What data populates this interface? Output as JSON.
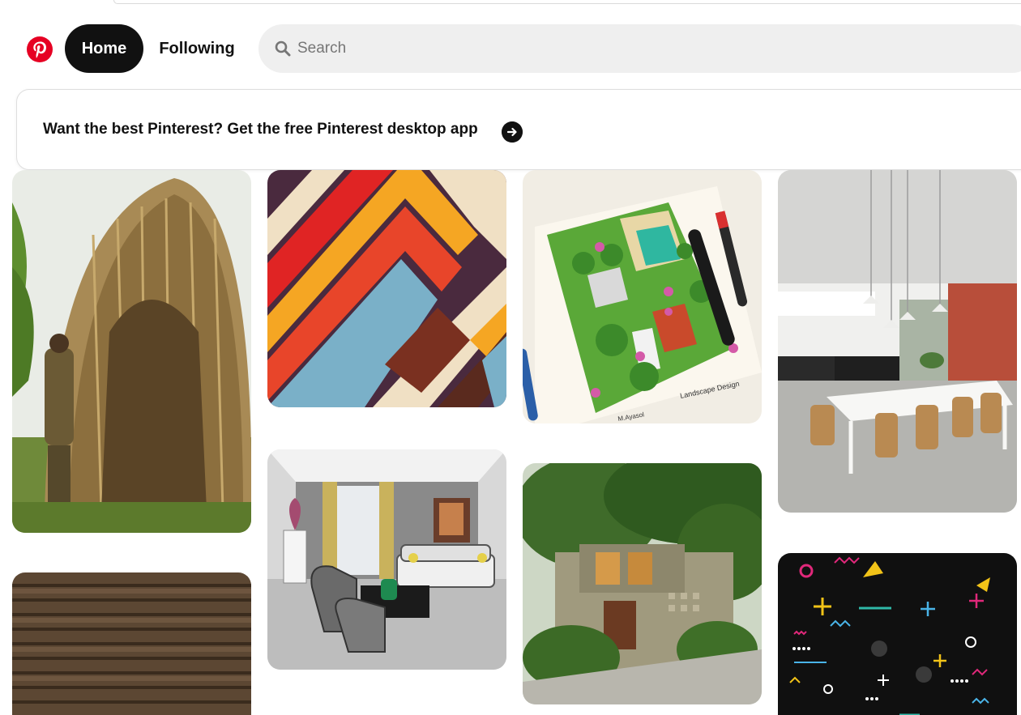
{
  "header": {
    "logo_icon": "pinterest-logo-icon",
    "brand_color": "#e60023",
    "nav": {
      "home_label": "Home",
      "following_label": "Following"
    },
    "search": {
      "placeholder": "Search",
      "icon": "search-icon"
    }
  },
  "banner": {
    "text": "Want the best Pinterest? Get the free Pinterest desktop app",
    "arrow_icon": "arrow-right-icon"
  },
  "pins": [
    {
      "subject": "woven bamboo hut with man"
    },
    {
      "subject": "wood slat panel"
    },
    {
      "subject": "geometric zigzag stripes art"
    },
    {
      "subject": "interior living room sketch"
    },
    {
      "subject": "landscape design drawing notebook",
      "visible_text": [
        "Landscape Design",
        "M.Ayasol"
      ]
    },
    {
      "subject": "modern house with trees"
    },
    {
      "subject": "minimal dining kitchen interior"
    },
    {
      "subject": "memphis pattern on black"
    }
  ]
}
